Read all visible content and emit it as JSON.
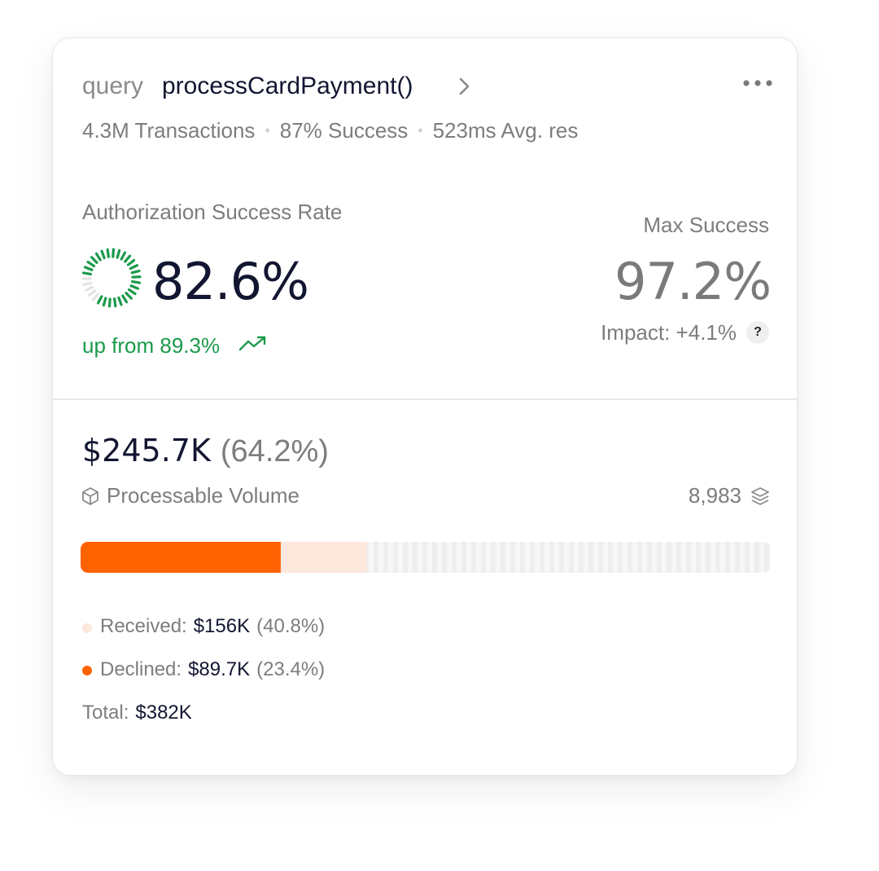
{
  "header": {
    "query_prefix": "query",
    "query_name": "processCardPayment()",
    "stats": [
      "4.3M Transactions",
      "87% Success",
      "523ms Avg. res"
    ]
  },
  "auth": {
    "label": "Authorization Success Rate",
    "value": "82.6%",
    "ring_fraction": 0.826,
    "trend_text": "up from 89.3%"
  },
  "max": {
    "label": "Max Success",
    "value": "97.2%",
    "impact": "Impact: +4.1%",
    "help": "?"
  },
  "volume": {
    "amount": "$245.7K",
    "percent": "(64.2%)",
    "label": "Processable Volume",
    "count": "8,983",
    "bar": {
      "declined_fraction": 0.234,
      "received_fraction": 0.408
    }
  },
  "legend": {
    "received": {
      "label": "Received:",
      "value": "$156K",
      "percent": "(40.8%)"
    },
    "declined": {
      "label": "Declined:",
      "value": "$89.7K",
      "percent": "(23.4%)"
    },
    "total": {
      "label": "Total:",
      "value": "$382K"
    }
  },
  "colors": {
    "accent": "#ff6200",
    "accent_light": "#fde8dd",
    "success": "#1a9a4a",
    "text_dark": "#121631",
    "text_muted": "#7d7d7d"
  },
  "icons": {
    "chevron": "chevron-right-icon",
    "more": "more-horizontal-icon",
    "trend": "trending-up-icon",
    "help": "question-icon",
    "cube": "cube-icon",
    "layers": "layers-icon"
  }
}
